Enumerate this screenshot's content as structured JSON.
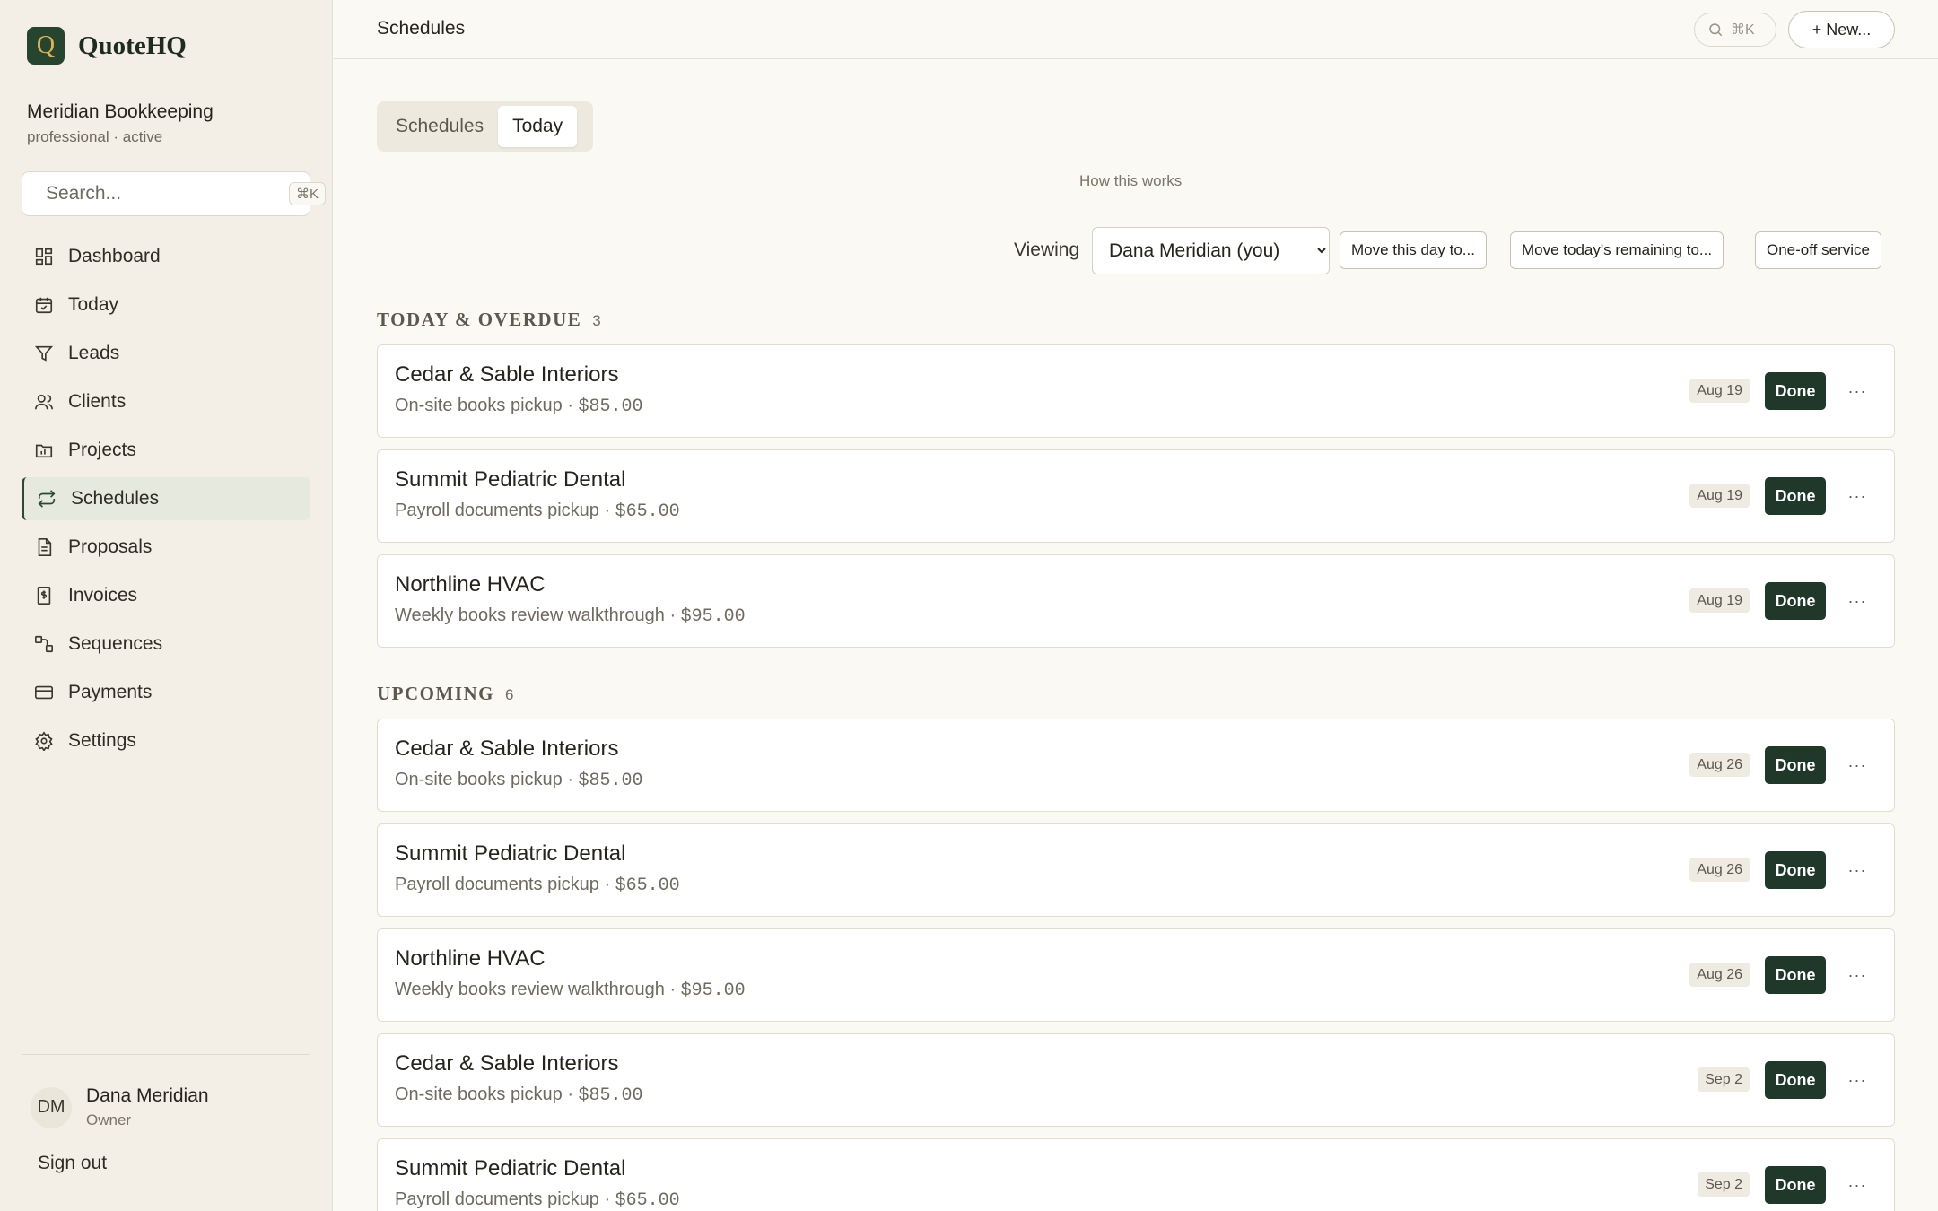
{
  "app": {
    "logo_letter": "Q",
    "name": "QuoteHQ",
    "colors": {
      "brand": "#27442f",
      "accent": "#d9b45c",
      "done_button": "#20382a"
    }
  },
  "org": {
    "name": "Meridian Bookkeeping",
    "subtitle": "professional · active"
  },
  "sidebar_search": {
    "placeholder": "Search...",
    "shortcut": "⌘K"
  },
  "nav": [
    {
      "label": "Dashboard",
      "icon": "dashboard-icon"
    },
    {
      "label": "Today",
      "icon": "calendar-icon"
    },
    {
      "label": "Leads",
      "icon": "filter-icon"
    },
    {
      "label": "Clients",
      "icon": "users-icon"
    },
    {
      "label": "Projects",
      "icon": "folder-icon"
    },
    {
      "label": "Schedules",
      "icon": "repeat-icon",
      "active": true
    },
    {
      "label": "Proposals",
      "icon": "document-icon"
    },
    {
      "label": "Invoices",
      "icon": "invoice-icon"
    },
    {
      "label": "Sequences",
      "icon": "sequence-icon"
    },
    {
      "label": "Payments",
      "icon": "card-icon"
    },
    {
      "label": "Settings",
      "icon": "gear-icon"
    }
  ],
  "user": {
    "initials": "DM",
    "name": "Dana Meridian",
    "role": "Owner",
    "signout": "Sign out"
  },
  "topbar": {
    "title": "Schedules",
    "search_shortcut": "⌘K",
    "new_label": "+ New..."
  },
  "tabs": [
    {
      "label": "Schedules"
    },
    {
      "label": "Today",
      "active": true
    }
  ],
  "how_link": "How this works",
  "viewing": {
    "label": "Viewing",
    "selected": "Dana Meridian (you)",
    "actions": [
      "Move this day to...",
      "Move today's remaining to...",
      "One-off service"
    ]
  },
  "sections": [
    {
      "title": "TODAY & OVERDUE",
      "count": "3",
      "rows": [
        {
          "client": "Cedar & Sable Interiors",
          "service": "On-site books pickup",
          "price": "$85.00",
          "date": "Aug 19"
        },
        {
          "client": "Summit Pediatric Dental",
          "service": "Payroll documents pickup",
          "price": "$65.00",
          "date": "Aug 19"
        },
        {
          "client": "Northline HVAC",
          "service": "Weekly books review walkthrough",
          "price": "$95.00",
          "date": "Aug 19"
        }
      ]
    },
    {
      "title": "UPCOMING",
      "count": "6",
      "rows": [
        {
          "client": "Cedar & Sable Interiors",
          "service": "On-site books pickup",
          "price": "$85.00",
          "date": "Aug 26"
        },
        {
          "client": "Summit Pediatric Dental",
          "service": "Payroll documents pickup",
          "price": "$65.00",
          "date": "Aug 26"
        },
        {
          "client": "Northline HVAC",
          "service": "Weekly books review walkthrough",
          "price": "$95.00",
          "date": "Aug 26"
        },
        {
          "client": "Cedar & Sable Interiors",
          "service": "On-site books pickup",
          "price": "$85.00",
          "date": "Sep 2"
        },
        {
          "client": "Summit Pediatric Dental",
          "service": "Payroll documents pickup",
          "price": "$65.00",
          "date": "Sep 2"
        }
      ]
    }
  ],
  "row_actions": {
    "done": "Done",
    "more": "···"
  }
}
